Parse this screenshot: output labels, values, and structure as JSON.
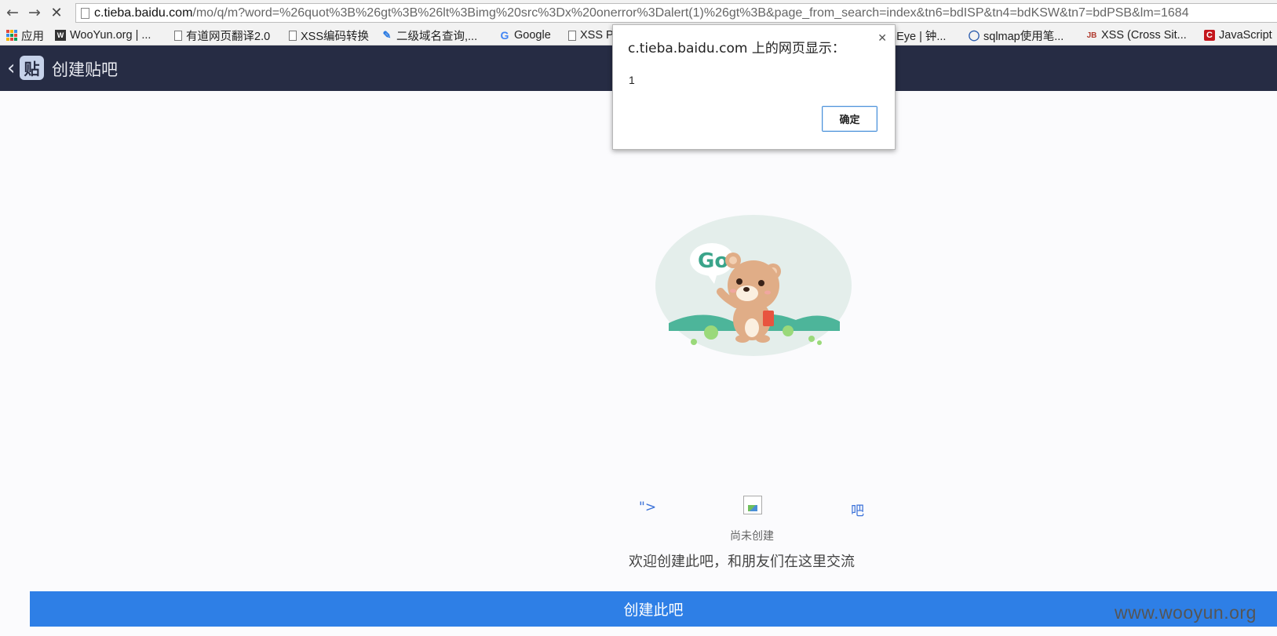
{
  "browser": {
    "url_host": "c.tieba.baidu.com",
    "url_rest": "/mo/q/m?word=%26quot%3B%26gt%3B%26lt%3Bimg%20src%3Dx%20onerror%3Dalert(1)%26gt%3B&page_from_search=index&tn6=bdISP&tn4=bdKSW&tn7=bdPSB&lm=1684",
    "back_icon": "arrow-left-icon",
    "forward_icon": "arrow-right-icon",
    "stop_icon": "close-icon"
  },
  "bookmarks": [
    {
      "label": "应用",
      "icon": "apps-grid-icon"
    },
    {
      "label": "WooYun.org | ...",
      "icon": "wooyun-icon"
    },
    {
      "label": "有道网页翻译2.0",
      "icon": "page-icon"
    },
    {
      "label": "XSS编码转换",
      "icon": "page-icon"
    },
    {
      "label": "二级域名查询,...",
      "icon": "pen-icon"
    },
    {
      "label": "Google",
      "icon": "google-icon"
    },
    {
      "label": "XSS P",
      "icon": "page-icon"
    },
    {
      "label": "nEye | 钟...",
      "icon": ""
    },
    {
      "label": "sqlmap使用笔...",
      "icon": "shield-icon"
    },
    {
      "label": "XSS (Cross Sit...",
      "icon": "jb-icon"
    },
    {
      "label": "JavaScript",
      "icon": "c-icon"
    }
  ],
  "header": {
    "title": "创建贴吧",
    "logo_text": "贴"
  },
  "illustration": {
    "bubble_text": "Go"
  },
  "content": {
    "row_left": "\">",
    "row_right": "吧",
    "status": "尚未创建",
    "welcome": "欢迎创建此吧，和朋友们在这里交流",
    "create_button": "创建此吧"
  },
  "watermark": "www.wooyun.org",
  "dialog": {
    "title": "c.tieba.baidu.com 上的网页显示：",
    "message": "1",
    "ok_label": "确定",
    "close_icon": "close-icon"
  },
  "colors": {
    "header_bg": "#262c44",
    "accent_blue": "#2e7fe6",
    "link_blue": "#3b72d9"
  }
}
